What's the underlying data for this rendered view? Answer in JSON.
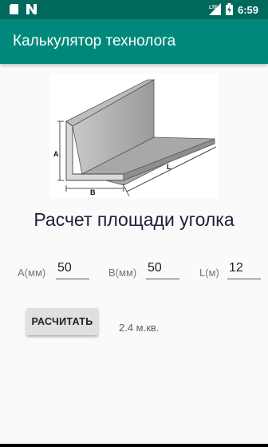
{
  "status_bar": {
    "time": "6:59",
    "left_icons": [
      "sd-card-icon",
      "n-logo-icon"
    ],
    "right_icons": [
      "lte-signal-icon",
      "battery-icon"
    ]
  },
  "app_bar": {
    "title": "Калькулятор технолога"
  },
  "illustration": {
    "label_a": "A",
    "label_b": "B",
    "label_l": "L"
  },
  "heading": "Расчет площади уголка",
  "fields": [
    {
      "label": "A(мм)",
      "value": "50"
    },
    {
      "label": "B(мм)",
      "value": "50"
    },
    {
      "label": "L(м)",
      "value": "12"
    }
  ],
  "calculate_button": "РАСЧИТАТЬ",
  "result": "2.4 м.кв.",
  "colors": {
    "primary": "#00897b",
    "primary_dark": "#00695c"
  }
}
